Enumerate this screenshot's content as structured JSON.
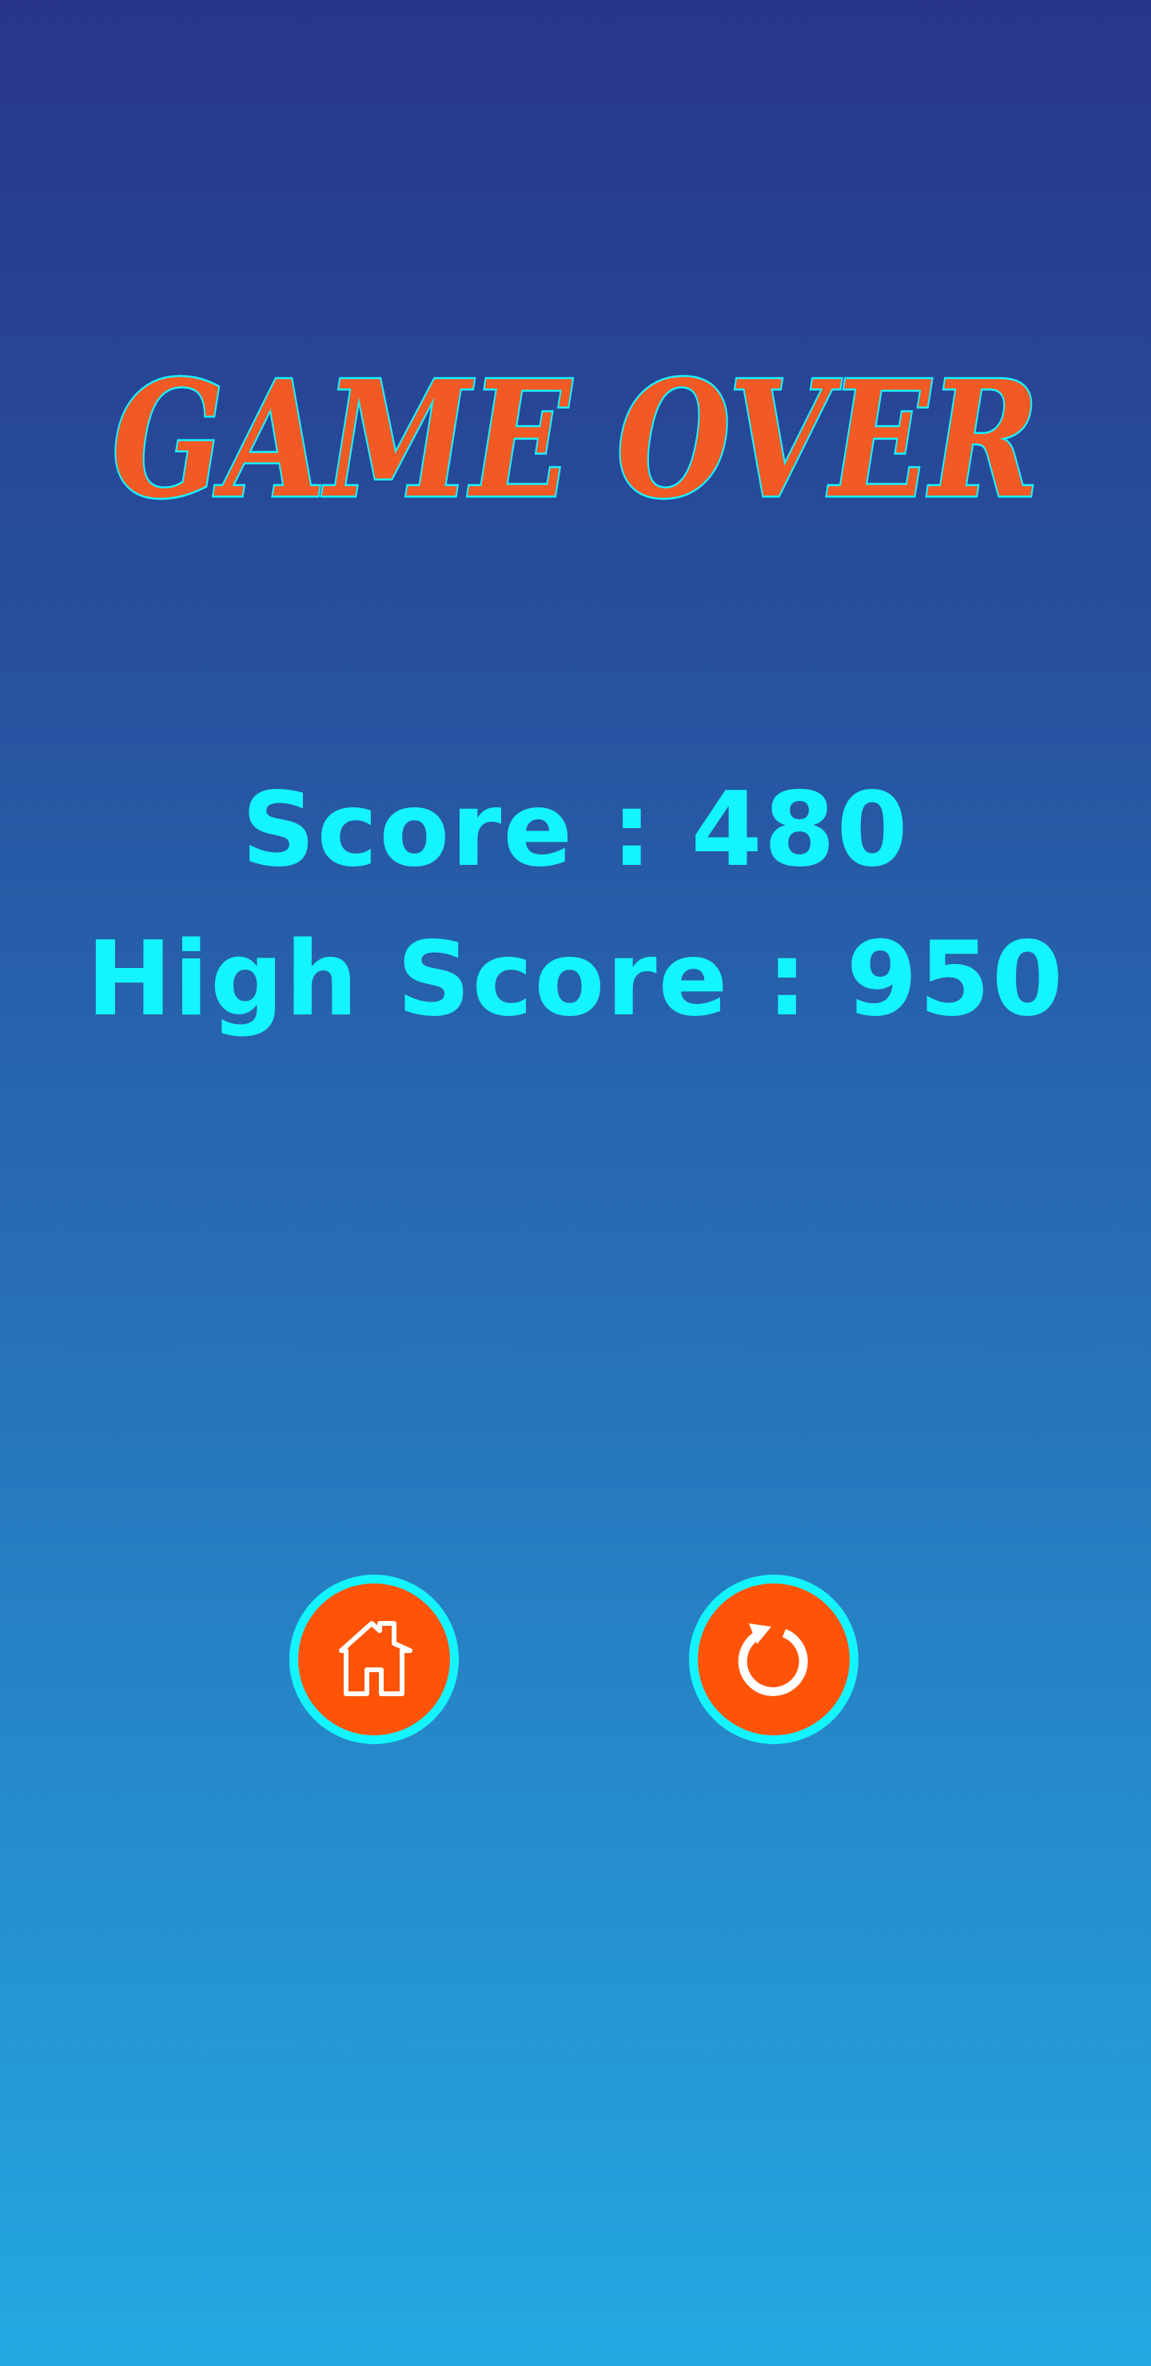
{
  "title": {
    "text": "GAME OVER"
  },
  "score": {
    "label": "Score : 480",
    "value": 480
  },
  "high_score": {
    "label": "High Score : 950",
    "value": 950
  },
  "buttons": {
    "home": {
      "icon": "home-icon"
    },
    "restart": {
      "icon": "restart-icon"
    }
  },
  "colors": {
    "title_fill": "#f15a24",
    "title_outline": "#14f4ff",
    "score_text": "#14f4ff",
    "button_fill": "#ff5408",
    "button_ring": "#14f4ff",
    "background_top": "#28358a",
    "background_bottom": "#24a8e1"
  }
}
